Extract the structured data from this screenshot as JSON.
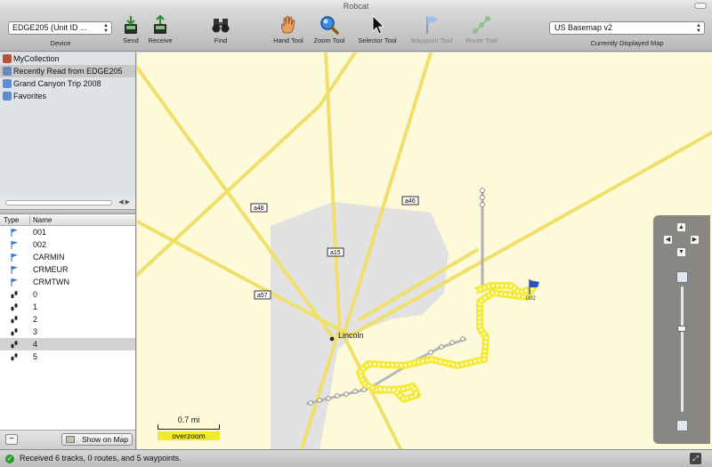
{
  "window": {
    "title": "Robcat"
  },
  "toolbar": {
    "device_value": "EDGE205 (Unit ID ...",
    "device_caption": "Device",
    "send_label": "Send",
    "receive_label": "Receive",
    "find_label": "Find",
    "hand_label": "Hand Tool",
    "zoom_label": "Zoom Tool",
    "selector_label": "Selector Tool",
    "waypoint_label": "Waypoint Tool",
    "route_label": "Route Tool",
    "map_value": "US Basemap v2",
    "map_caption": "Currently Displayed Map"
  },
  "collections": [
    {
      "label": "MyCollection",
      "icon": "collection-icon",
      "color": "#b5523a"
    },
    {
      "label": "Recently Read from EDGE205",
      "icon": "device-folder-icon",
      "color": "#6a86b8"
    },
    {
      "label": "Grand Canyon Trip 2008",
      "icon": "folder-icon",
      "color": "#5a8ed0"
    },
    {
      "label": "Favorites",
      "icon": "folder-icon",
      "color": "#5a8ed0"
    }
  ],
  "list": {
    "col_type": "Type",
    "col_name": "Name",
    "rows": [
      {
        "type": "waypoint-flag-icon",
        "name": "001"
      },
      {
        "type": "waypoint-flag-icon",
        "name": "002"
      },
      {
        "type": "waypoint-flag-icon",
        "name": "CARMIN"
      },
      {
        "type": "waypoint-flag-icon",
        "name": "CRMEUR"
      },
      {
        "type": "waypoint-flag-icon",
        "name": "CRMTWN"
      },
      {
        "type": "track-footprints-icon",
        "name": "0"
      },
      {
        "type": "track-footprints-icon",
        "name": "1"
      },
      {
        "type": "track-footprints-icon",
        "name": "2"
      },
      {
        "type": "track-footprints-icon",
        "name": "3"
      },
      {
        "type": "track-footprints-icon",
        "name": "4"
      },
      {
        "type": "track-footprints-icon",
        "name": "5"
      }
    ]
  },
  "sidebar_footer": {
    "remove_label": "−",
    "show_on_map_label": "Show on Map"
  },
  "map": {
    "roads": [
      "a46",
      "a46",
      "a15",
      "a57"
    ],
    "city": "Lincoln",
    "waypoint_label": "002",
    "scale_label": "0.7 mi",
    "overzoom_label": "overzoom",
    "colors": {
      "background": "#fcfad9",
      "road": "#f0df6a",
      "area": "#e4e4e4",
      "track_highlight": "#f5e93a"
    }
  },
  "status": {
    "text": "Received 6 tracks, 0 routes, and 5 waypoints."
  }
}
